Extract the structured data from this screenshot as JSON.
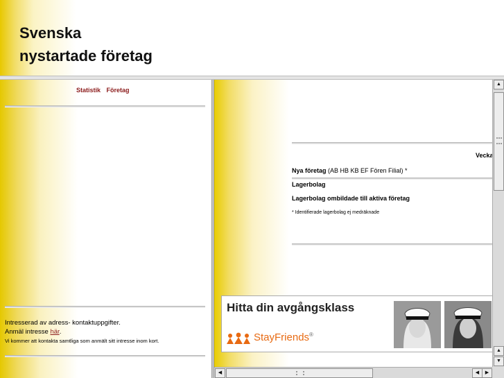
{
  "header": {
    "title_line1": "Svenska",
    "title_line2": "nystartade företag"
  },
  "left_nav": {
    "items": [
      {
        "label": "Statistik"
      },
      {
        "label": "Företag"
      }
    ]
  },
  "contact": {
    "line1": "Intresserad av adress- kontaktuppgifter.",
    "line2_prefix": "Anmäl intresse ",
    "line2_link": "här",
    "line2_suffix": ".",
    "line3": "Vi kommer att kontakta samtliga som anmält sitt intresse inom kort."
  },
  "main": {
    "week_label": "Vecka",
    "stats": {
      "new_label": "Nya företag",
      "new_types": " (AB HB KB EF Fören Filial) *",
      "lager_label": "Lagerbolag",
      "lager_converted_label": "Lagerbolag ombildade till aktiva företag",
      "footnote": "* Identifierade lagerbolag ej medräknade"
    }
  },
  "ad": {
    "headline": "Hitta din avgångsklass",
    "brand": "StayFriends",
    "brand_mark": "®",
    "brand_color": "#e86a12"
  },
  "scrollbars": {
    "up_icon": "▲",
    "down_icon": "▼",
    "left_icon": "◀",
    "right_icon": "▶"
  },
  "colors": {
    "accent_yellow": "#e8c800",
    "link_red": "#8b1a1a"
  }
}
